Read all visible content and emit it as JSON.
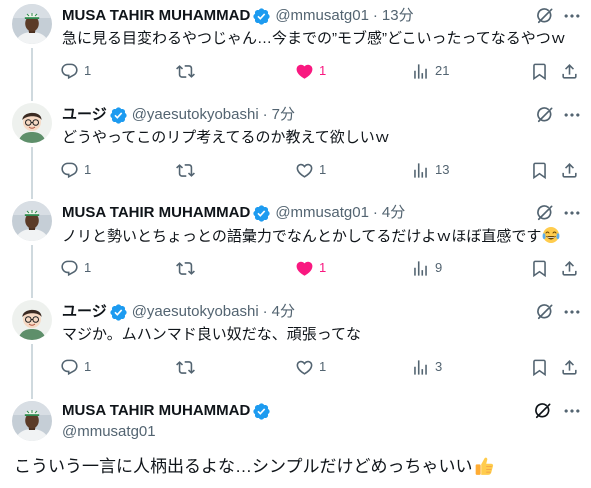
{
  "colors": {
    "text": "#0f1419",
    "secondary": "#536471",
    "verified": "#1d9bf0",
    "like": "#f91880",
    "thread_line": "#cfd9de",
    "background": "#ffffff"
  },
  "icons": {
    "verified": "verified-badge-icon",
    "grok": "grok-icon",
    "more": "more-icon",
    "reply": "reply-icon",
    "retweet": "retweet-icon",
    "like": "heart-icon",
    "views": "views-icon",
    "bookmark": "bookmark-icon",
    "share": "share-icon"
  },
  "meta_separator": "·",
  "thread": [
    {
      "name": "MUSA TAHIR MUHAMMAD",
      "handle": "@mmusatg01",
      "time": "13分",
      "text": "急に見る目変わるやつじゃん…今までの”モブ感”どこいったってなるやつｗ",
      "replies": "1",
      "likes": "1",
      "views": "21",
      "liked": true
    },
    {
      "name": "ユージ",
      "handle": "@yaesutokyobashi",
      "time": "7分",
      "text": "どうやってこのリプ考えてるのか教えて欲しいｗ",
      "replies": "1",
      "likes": "1",
      "views": "13",
      "liked": false
    },
    {
      "name": "MUSA TAHIR MUHAMMAD",
      "handle": "@mmusatg01",
      "time": "4分",
      "text": "ノリと勢いとちょっとの語彙力でなんとかしてるだけよｗほぼ直感です",
      "emoji_icon": "face-with-tears-of-joy-emoji",
      "replies": "1",
      "likes": "1",
      "views": "9",
      "liked": true
    },
    {
      "name": "ユージ",
      "handle": "@yaesutokyobashi",
      "time": "4分",
      "text": "マジか。ムハンマド良い奴だな、頑張ってな",
      "replies": "1",
      "likes": "1",
      "views": "3",
      "liked": false
    }
  ],
  "focused": {
    "name": "MUSA TAHIR MUHAMMAD",
    "handle": "@mmusatg01",
    "text": "こういう一言に人柄出るよな…シンプルだけどめっちゃいい",
    "emoji_icon": "thumbs-up-emoji"
  }
}
